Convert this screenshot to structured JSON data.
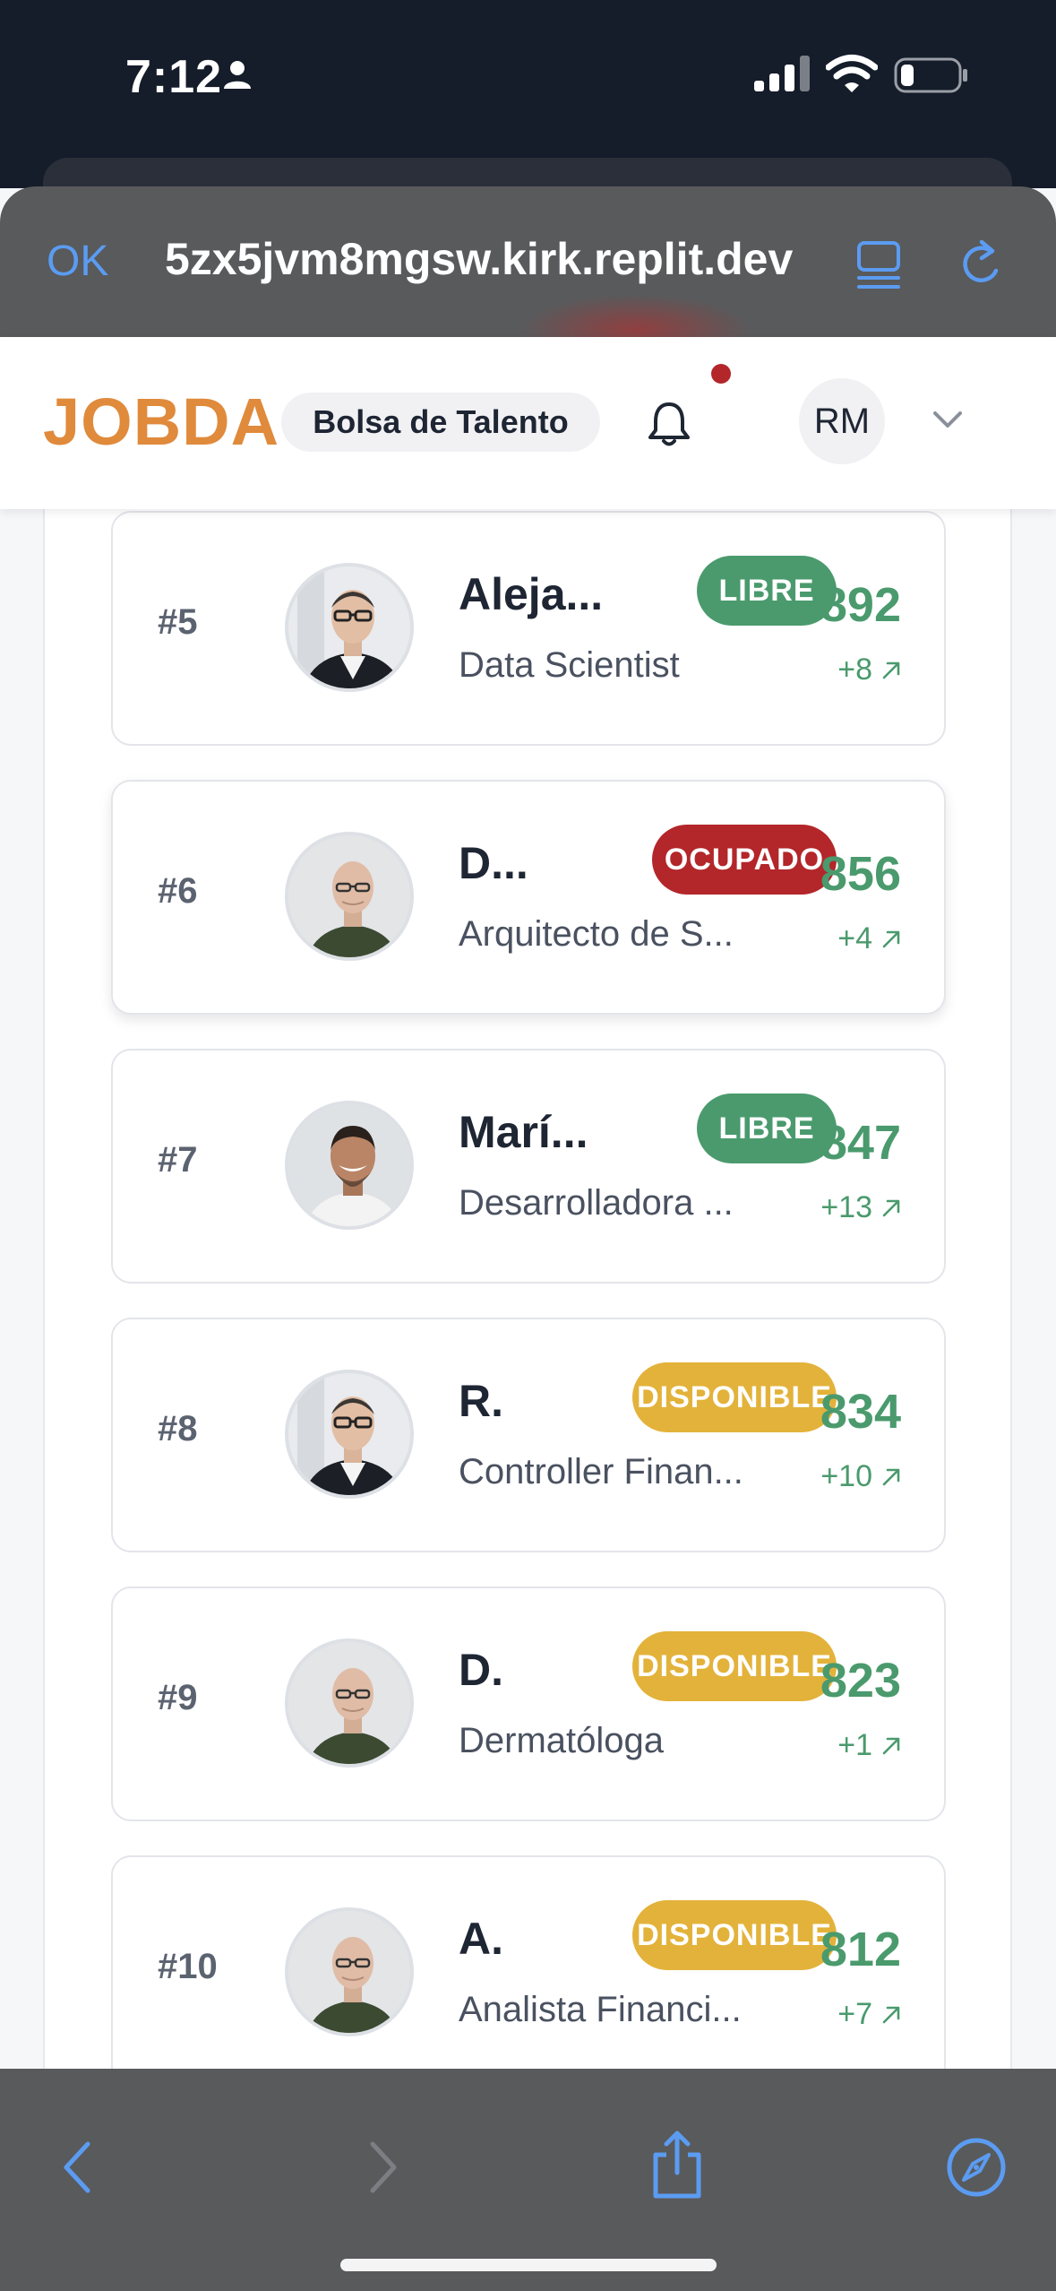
{
  "status_bar": {
    "time": "7:12"
  },
  "browser": {
    "ok_label": "OK",
    "url": "5zx5jvm8mgsw.kirk.replit.dev"
  },
  "header": {
    "logo": "JOBDA",
    "section_chip": "Bolsa de Talento",
    "user_initials": "RM",
    "has_notification": true
  },
  "colors": {
    "accent": "#e08a3c",
    "libre": "#4a9a6d",
    "ocupado": "#b3262a",
    "disponible": "#e3b23a",
    "score": "#4a9a6d"
  },
  "candidates": [
    {
      "rank": "#5",
      "name": "Aleja...",
      "status": "LIBRE",
      "role": "Data Scientist",
      "score": "892",
      "delta": "+8",
      "avatar": "man-glasses-blazer"
    },
    {
      "rank": "#6",
      "name": "D...",
      "status": "OCUPADO",
      "role": "Arquitecto de S...",
      "score": "856",
      "delta": "+4",
      "avatar": "bald-man-green-shirt"
    },
    {
      "rank": "#7",
      "name": "Marí...",
      "status": "LIBRE",
      "role": "Desarrolladora ...",
      "score": "847",
      "delta": "+13",
      "avatar": "smiling-man-white-shirt"
    },
    {
      "rank": "#8",
      "name": "R.",
      "status": "DISPONIBLE",
      "role": "Controller Finan...",
      "score": "834",
      "delta": "+10",
      "avatar": "man-glasses-blazer"
    },
    {
      "rank": "#9",
      "name": "D.",
      "status": "DISPONIBLE",
      "role": "Dermatóloga",
      "score": "823",
      "delta": "+1",
      "avatar": "bald-man-green-shirt"
    },
    {
      "rank": "#10",
      "name": "A.",
      "status": "DISPONIBLE",
      "role": "Analista Financi...",
      "score": "812",
      "delta": "+7",
      "avatar": "bald-man-green-shirt"
    }
  ]
}
